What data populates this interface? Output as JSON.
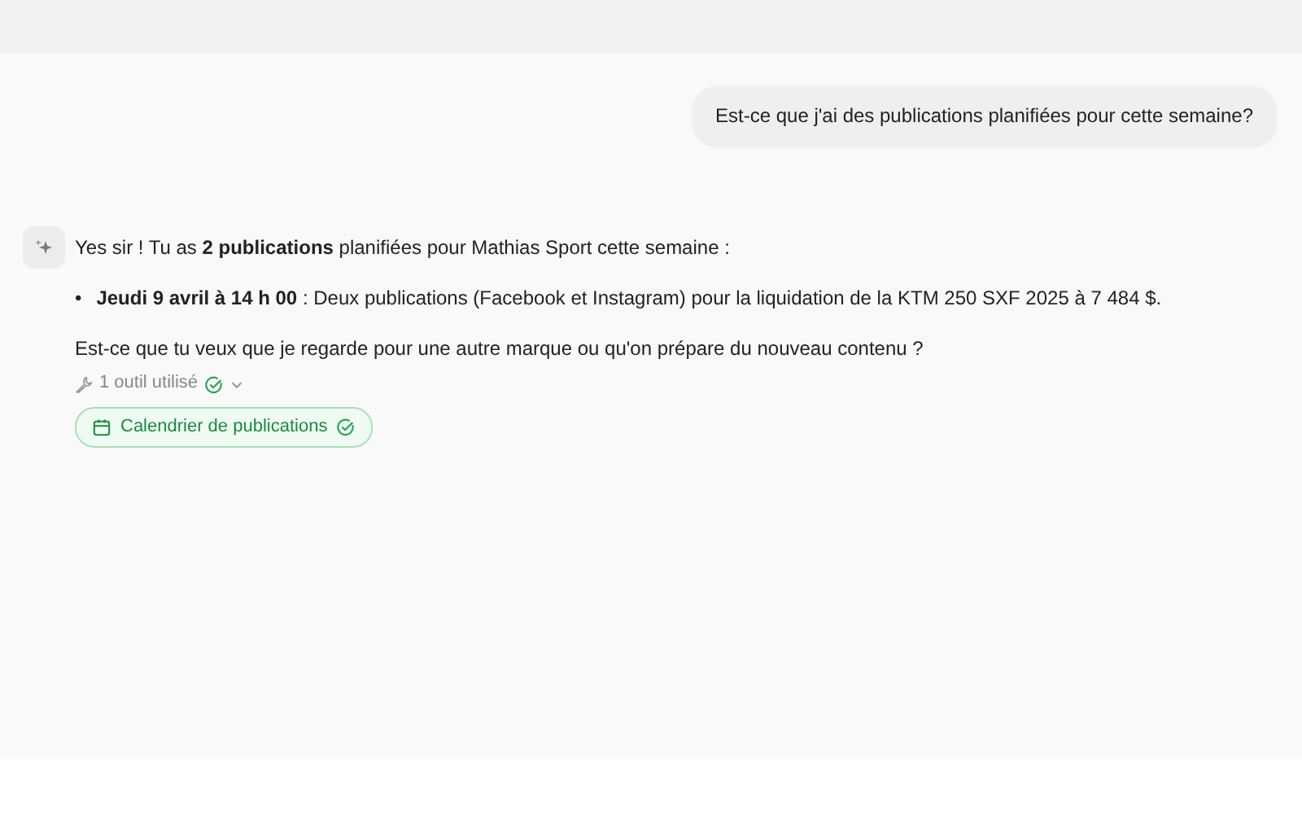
{
  "user_message": {
    "text": "Est-ce que j'ai des publications planifiées pour cette semaine?"
  },
  "assistant_message": {
    "intro": "Yes sir ! Tu as **2 publications** planifiées pour Mathias Sport cette semaine :",
    "bullets": [
      {
        "marker": "•",
        "text": "**Jeudi 9 avril à 14 h 00** : Deux publications (Facebook et Instagram) pour la liquidation de la KTM 250 SXF 2025 à 7 484 $."
      }
    ],
    "question": "Est-ce que tu veux que je regarde pour une autre marque ou qu'on prépare du nouveau contenu ?",
    "tools_summary": {
      "label": "1 outil utilisé",
      "done": true,
      "expanded": false
    },
    "tool_chips": [
      {
        "label": "Calendrier de publications",
        "done": true
      }
    ]
  }
}
